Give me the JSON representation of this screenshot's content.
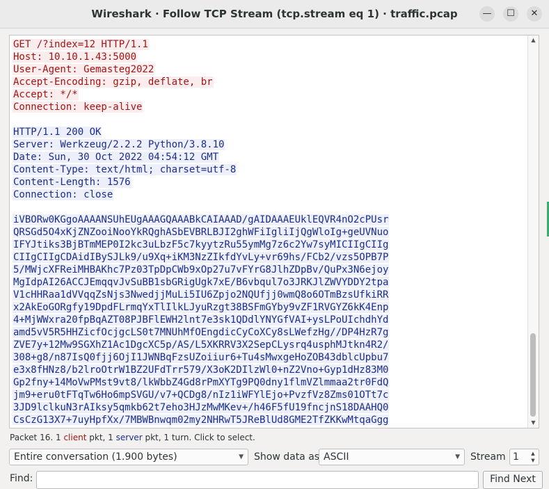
{
  "window": {
    "title": "Wireshark · Follow TCP Stream (tcp.stream eq 1) · traffic.pcap",
    "minimize_glyph": "—",
    "maximize_glyph": "☐",
    "close_glyph": "✕"
  },
  "stream": {
    "client_request": [
      "GET /?index=12 HTTP/1.1",
      "Host: 10.10.1.43:5000",
      "User-Agent: Gemasteg2022",
      "Accept-Encoding: gzip, deflate, br",
      "Accept: */*",
      "Connection: keep-alive"
    ],
    "server_headers": [
      "HTTP/1.1 200 OK",
      "Server: Werkzeug/2.2.2 Python/3.8.10",
      "Date: Sun, 30 Oct 2022 04:54:12 GMT",
      "Content-Type: text/html; charset=utf-8",
      "Content-Length: 1576",
      "Connection: close"
    ],
    "server_body": [
      "iVBORw0KGgoAAAANSUhEUgAAAGQAAABkCAIAAAD/gAIDAAAEUklEQVR4nO2cPUsr",
      "QRSGd5O4xKjZNZooiNooYkRQghASbEVBRLBJI2ghWFiIgliIjQgWloIg+geUVNuo",
      "IFYJtiks3BjBTmMEP0I2kc3uLbzF5c7kyytzRu55ymMg7z6c2Yw7syMICIIgCIIg",
      "CIIgCIIgCDAidIBySJLk9/u9Xq+iKM3NzZIkfdYvLy+vr69hs/FCb2/vzs5OPB7P",
      "5/MWjcXFReiMHBAKhc7Pz03TpDpCWb9xOp27u7vFYrG8JlhZDpBv/QuPx3N6ejoy",
      "MgIdpAI26ACCJEmqqvJvSuBB1sbGRigUgk7xE/B6vbqul7o3JRKJlZWVYDDY2tpa",
      "V1cHHRaa1dVVqqZsNjs3NwedjjMuLi5IU6Zpjo2NQUfjj0wmQ8o6OTmBzsUfkiRR",
      "x2AkEoGORgfy19DpdFLrmqYxTlIlkLJyuRzgt38BSFmGYby9vZF1RVGYZ6kK4Enp",
      "4+MjWWxra20fpBqAZT08PJBFlEWH2lnt7e3sk1QDdlYNYGfVAI+ysLPoUIchdhYd",
      "amd5vV5R5HHZicfOcjgcLS0t7MNUhMfOEngdicCyCoXCy8sLWefzHg//DP4HzR7g",
      "ZVE7y+12Mw9SGXhZ1Ac1DgcXC5p/AS/L5XKRRV3X2SepCLysrq4usphMJtkn4R2/",
      "308+g8/n87IsQ0fjj6OjI1JWNBqFzsUZoiiur6+Tu4sMwxgeHoZOB43dblcUpbu7",
      "e3x8fHNz8/b2lroOtrW1BZ2UFdTrr579/X3oK2DIlzWl0+nZ2Vno+Gyp1dHz83M0",
      "Gp2fny+14MoVwPMst9vt8/lkWbbZ4Gd8rPmXYTg9PQ0dny1flmVZlmmaa2tr0FdQ",
      "jm9+eru0tFTqTw6Ho6mpSVGU/v7+QCDg8/nIz1iWFYlEjo+PvzfVz8Zms01OTt7c",
      "3JD9lclkuN3rAIksy5qmkb62t7eho3HJzMwMKev+/h46F5fU19fncjnS18DAAHQ0",
      "CsCzG13X7+7uyHpfXx/7MBWBnwqm02my2NHRwT5JReBlUd8GME2TfZKKwMtqaGgg",
      "…"
    ]
  },
  "status": {
    "packet": "Packet 16.",
    "client_count": "1",
    "client_word": "client",
    "pkt_sep": "pkt,",
    "server_count": "1",
    "server_word": "server",
    "tail": "pkt, 1 turn. Click to select."
  },
  "controls": {
    "conversation_value": "Entire conversation (1.900 bytes)",
    "show_data_label": "Show data as",
    "show_data_value": "ASCII",
    "stream_label": "Stream",
    "stream_value": "1",
    "find_label": "Find:",
    "find_placeholder": "",
    "find_next_label": "Find Next"
  }
}
